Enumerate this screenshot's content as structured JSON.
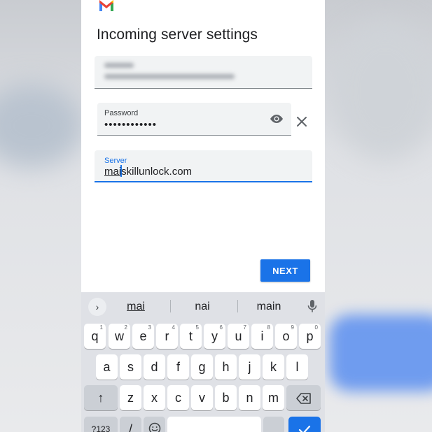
{
  "screen": {
    "title": "Incoming server settings"
  },
  "form": {
    "username": {
      "label": "",
      "value": ""
    },
    "password": {
      "label": "Password",
      "value": "••••••••••••"
    },
    "server": {
      "label": "Server",
      "value_before_cursor": "mai",
      "value_after_cursor": "skillunlock.com"
    }
  },
  "actions": {
    "next_label": "NEXT"
  },
  "keyboard": {
    "suggestions": [
      "mai",
      "nai",
      "main"
    ],
    "expand_symbol": "›",
    "row1": [
      {
        "key": "q",
        "hint": "1"
      },
      {
        "key": "w",
        "hint": "2"
      },
      {
        "key": "e",
        "hint": "3"
      },
      {
        "key": "r",
        "hint": "4"
      },
      {
        "key": "t",
        "hint": "5"
      },
      {
        "key": "y",
        "hint": "6"
      },
      {
        "key": "u",
        "hint": "7"
      },
      {
        "key": "i",
        "hint": "8"
      },
      {
        "key": "o",
        "hint": "9"
      },
      {
        "key": "p",
        "hint": "0"
      }
    ],
    "row2": [
      "a",
      "s",
      "d",
      "f",
      "g",
      "h",
      "j",
      "k",
      "l"
    ],
    "row3": [
      "z",
      "x",
      "c",
      "v",
      "b",
      "n",
      "m"
    ],
    "shift_symbol": "↑",
    "symbols_label": "?123",
    "comma_label": "/"
  },
  "colors": {
    "accent": "#1a73e8",
    "field_bg": "#f1f3f4",
    "keyboard_bg": "#dfe1e6"
  }
}
